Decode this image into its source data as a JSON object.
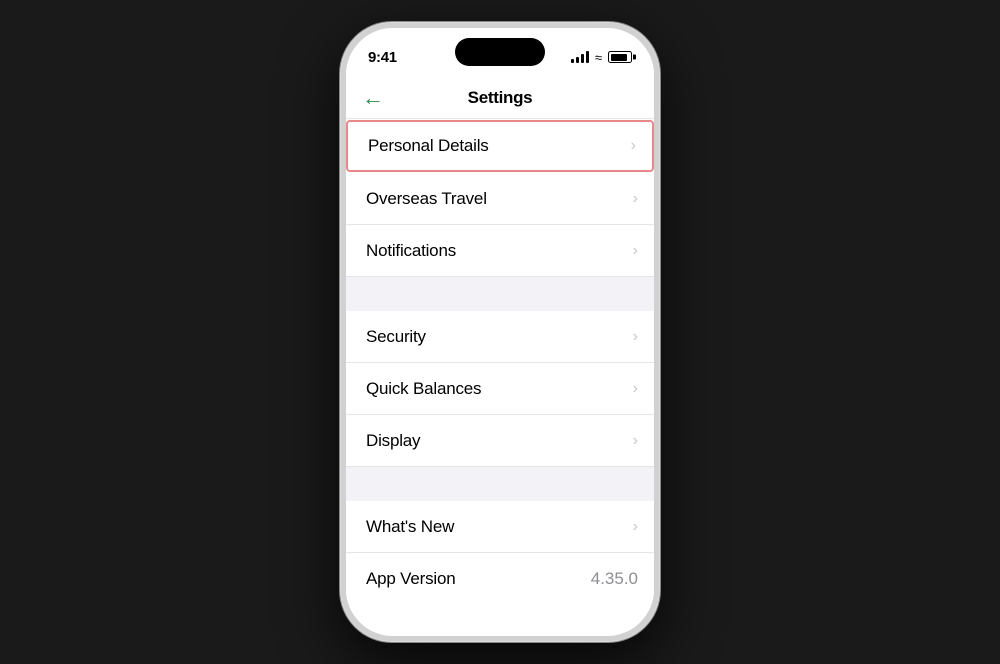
{
  "status": {
    "time": "9:41",
    "signal_bars": [
      4,
      6,
      8,
      10,
      12
    ],
    "battery_percent": 85
  },
  "header": {
    "title": "Settings",
    "back_label": "←"
  },
  "sections": [
    {
      "id": "section-1",
      "items": [
        {
          "id": "personal-details",
          "label": "Personal Details",
          "value": "",
          "highlighted": true
        },
        {
          "id": "overseas-travel",
          "label": "Overseas Travel",
          "value": "",
          "highlighted": false
        },
        {
          "id": "notifications",
          "label": "Notifications",
          "value": "",
          "highlighted": false
        }
      ]
    },
    {
      "id": "section-2",
      "items": [
        {
          "id": "security",
          "label": "Security",
          "value": "",
          "highlighted": false
        },
        {
          "id": "quick-balances",
          "label": "Quick Balances",
          "value": "",
          "highlighted": false
        },
        {
          "id": "display",
          "label": "Display",
          "value": "",
          "highlighted": false
        }
      ]
    },
    {
      "id": "section-3",
      "items": [
        {
          "id": "whats-new",
          "label": "What's New",
          "value": "",
          "highlighted": false
        },
        {
          "id": "app-version",
          "label": "App Version",
          "value": "4.35.0",
          "highlighted": false,
          "no_chevron": true
        }
      ]
    }
  ]
}
